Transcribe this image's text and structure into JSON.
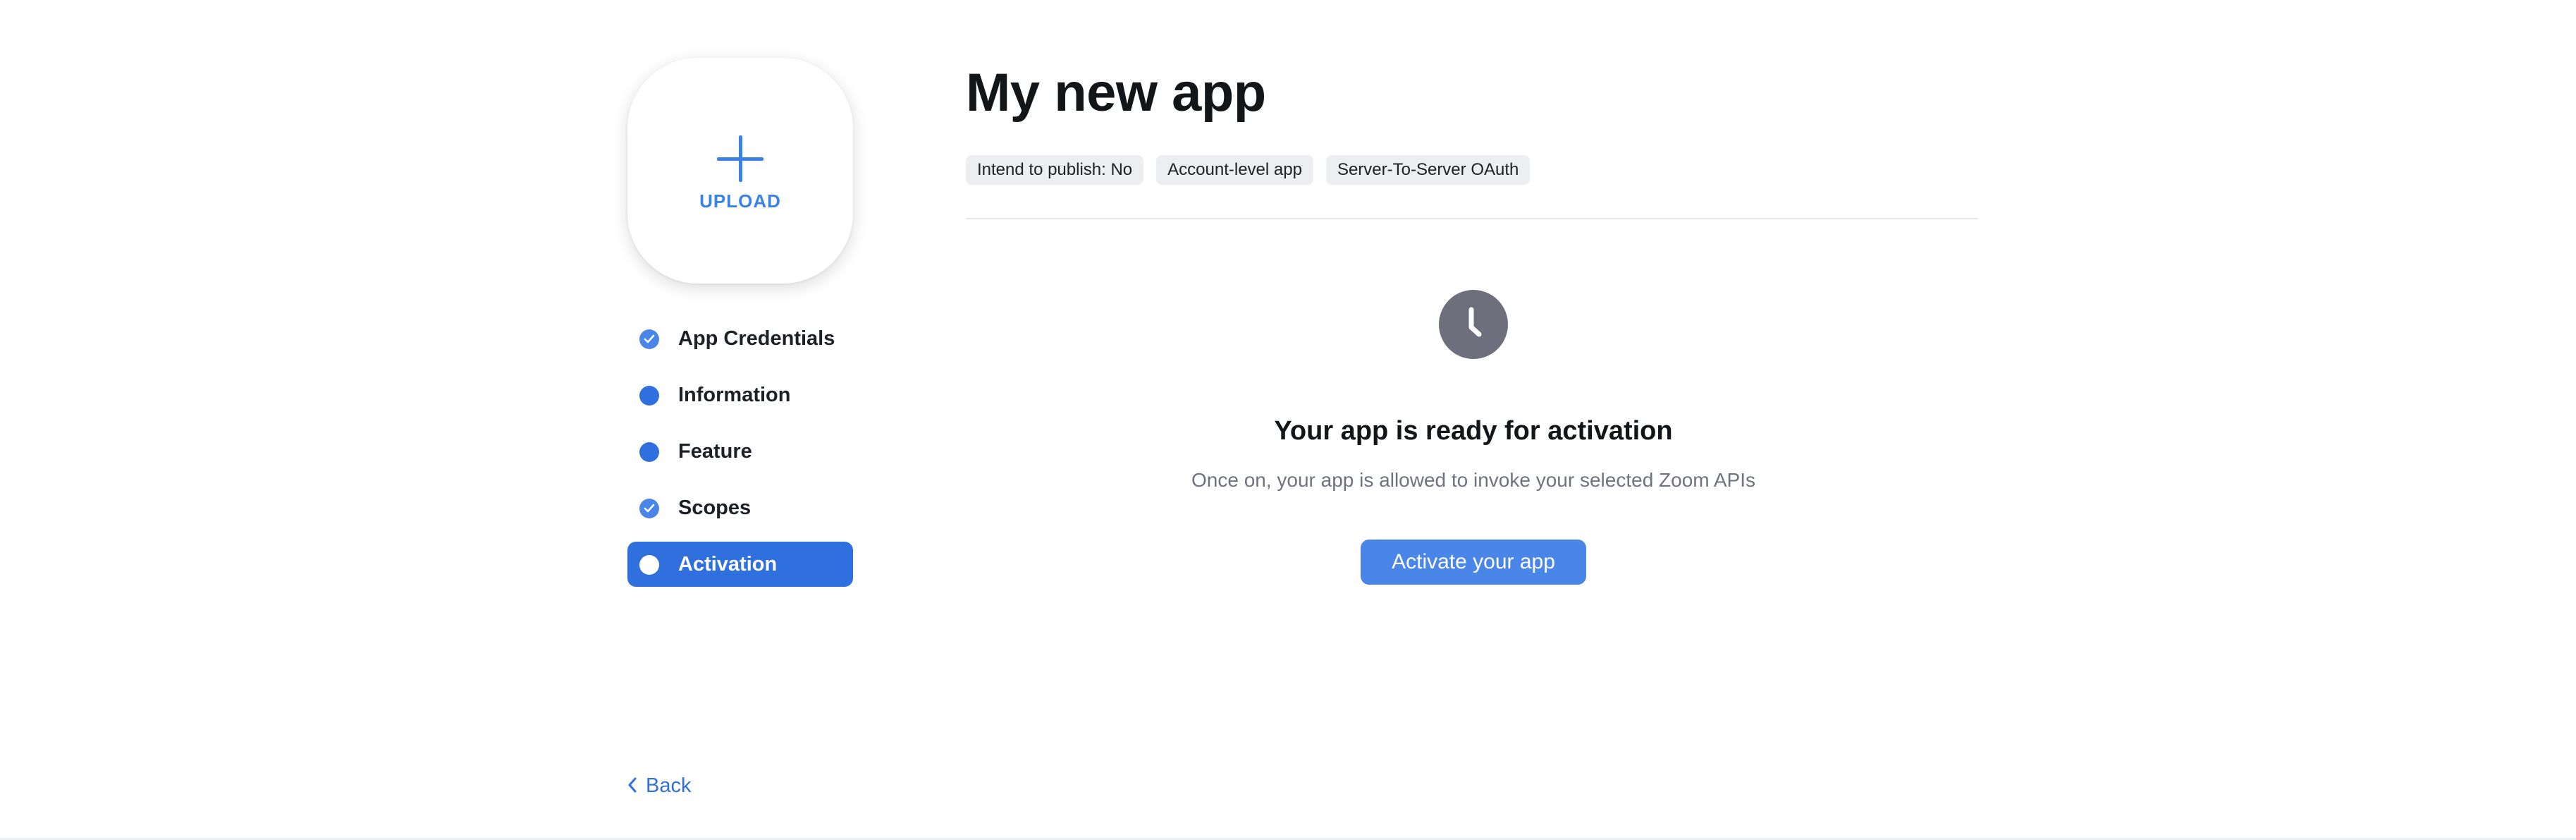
{
  "upload": {
    "label": "UPLOAD",
    "icon": "plus-icon"
  },
  "sidebar": {
    "items": [
      {
        "label": "App Credentials",
        "status": "completed",
        "icon": "check-circle-icon"
      },
      {
        "label": "Information",
        "status": "incomplete",
        "icon": "dot-icon"
      },
      {
        "label": "Feature",
        "status": "incomplete",
        "icon": "dot-icon"
      },
      {
        "label": "Scopes",
        "status": "completed",
        "icon": "check-circle-icon"
      },
      {
        "label": "Activation",
        "status": "active",
        "icon": "dot-icon"
      }
    ]
  },
  "back": {
    "label": "Back",
    "icon": "chevron-left-icon"
  },
  "main": {
    "title": "My new app",
    "tags": [
      "Intend to publish: No",
      "Account-level app",
      "Server-To-Server OAuth"
    ],
    "status_icon": "clock-icon",
    "heading": "Your app is ready for activation",
    "subtext": "Once on, your app is allowed to invoke your selected Zoom APIs",
    "activate_button": "Activate your app"
  },
  "colors": {
    "accent": "#2f6fde",
    "button": "#4a86e8",
    "clock": "#6e6f7c",
    "tag_bg": "#eceef2"
  }
}
